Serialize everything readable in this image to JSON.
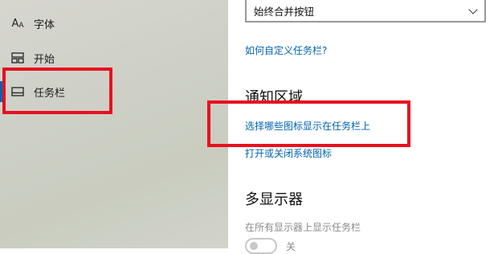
{
  "sidebar": {
    "items": [
      {
        "icon": "font-icon",
        "glyph": "A",
        "label": "字体"
      },
      {
        "icon": "start-icon",
        "label": "开始"
      },
      {
        "icon": "taskbar-icon",
        "label": "任务栏"
      }
    ]
  },
  "main": {
    "dropdown_value": "始终合并按钮",
    "link_customize": "如何自定义任务栏?",
    "notification_heading": "通知区域",
    "link_select_icons": "选择哪些图标显示在任务栏上",
    "link_system_icons": "打开或关闭系统图标",
    "multi_display_heading": "多显示器",
    "show_all_displays_label": "在所有显示器上显示任务栏",
    "toggle_state": "关"
  },
  "colors": {
    "accent": "#0063b1",
    "highlight": "#e8101f"
  }
}
